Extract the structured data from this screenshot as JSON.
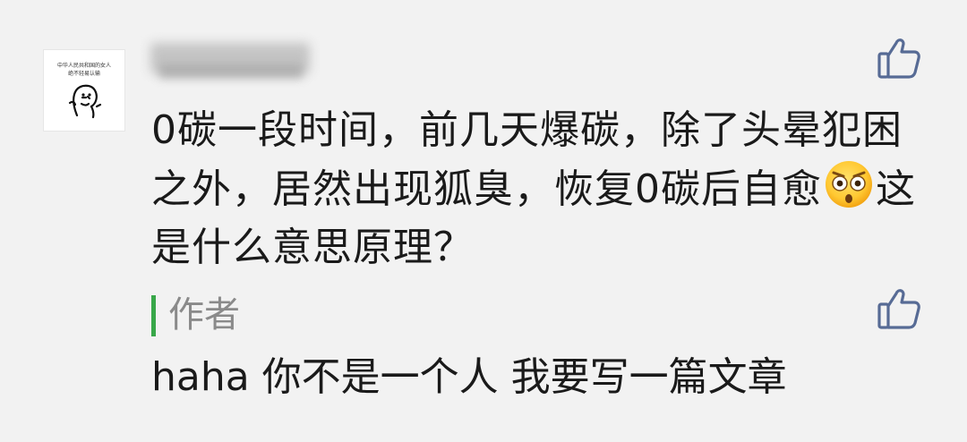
{
  "comment": {
    "avatar": {
      "text_line_1": "中华人民共和国的女人",
      "text_line_2": "绝不轻易认输"
    },
    "text_part_1": "0碳一段时间，前几天爆碳，除了头晕犯困之外，居然出现狐臭，恢复0碳后自愈",
    "emoji_icon": "shocked-face-icon",
    "text_part_2": "这是什么意思原理？",
    "like_icon": "thumbs-up-icon"
  },
  "reply": {
    "author_label": "作者",
    "text": "haha 你不是一个人  我要写一篇文章",
    "like_icon": "thumbs-up-icon"
  },
  "colors": {
    "background": "#f2f2f2",
    "text": "#1a1a1a",
    "author_bar": "#38a749",
    "author_label": "#8a8a8a",
    "like_icon": "#576b95"
  }
}
